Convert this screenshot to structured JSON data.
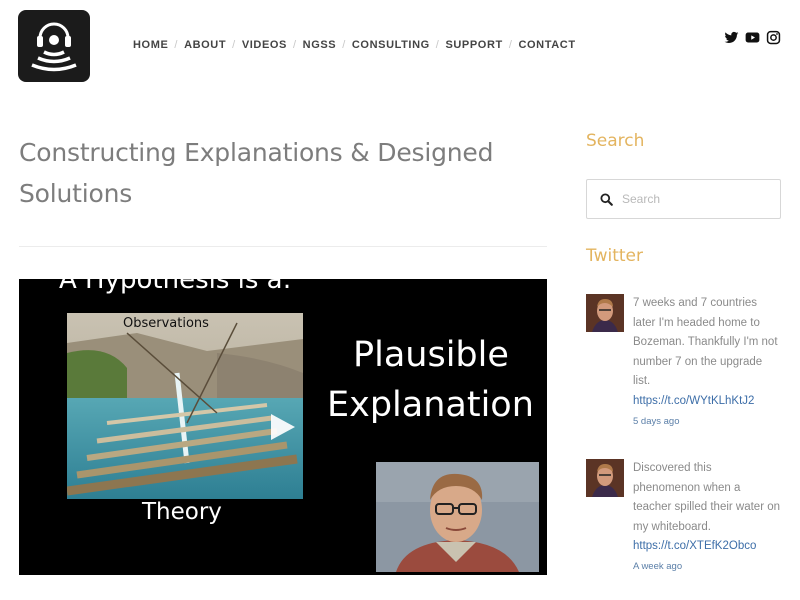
{
  "header": {
    "logo_icon": "headphones-signal-logo",
    "nav": [
      {
        "label": "HOME"
      },
      {
        "label": "ABOUT"
      },
      {
        "label": "VIDEOS"
      },
      {
        "label": "NGSS"
      },
      {
        "label": "CONSULTING"
      },
      {
        "label": "SUPPORT"
      },
      {
        "label": "CONTACT"
      }
    ],
    "social": [
      "twitter-icon",
      "youtube-icon",
      "instagram-icon"
    ]
  },
  "main": {
    "title": "Constructing Explanations & Designed Solutions",
    "video": {
      "slide_top_text": "A Hypothesis is a:",
      "observations_label": "Observations",
      "theory_label": "Theory",
      "big_line_1": "Plausible",
      "big_line_2": "Explanation",
      "play_icon": "play-icon"
    }
  },
  "sidebar": {
    "search_title": "Search",
    "search_placeholder": "Search",
    "twitter_title": "Twitter",
    "tweets": [
      {
        "text": "7 weeks and 7 countries later I'm headed home to Bozeman. Thankfully I'm not number 7 on the upgrade list.",
        "link": "https://t.co/WYtKLhKtJ2",
        "time": "5 days ago"
      },
      {
        "text": "Discovered this phenomenon when a teacher spilled their water on my whiteboard.",
        "link": "https://t.co/XTEfK2Obco",
        "time": "A week ago"
      }
    ]
  },
  "colors": {
    "accent": "#e3b45f",
    "title_gray": "#7d7d7d",
    "link_blue": "#3d6ea8"
  }
}
